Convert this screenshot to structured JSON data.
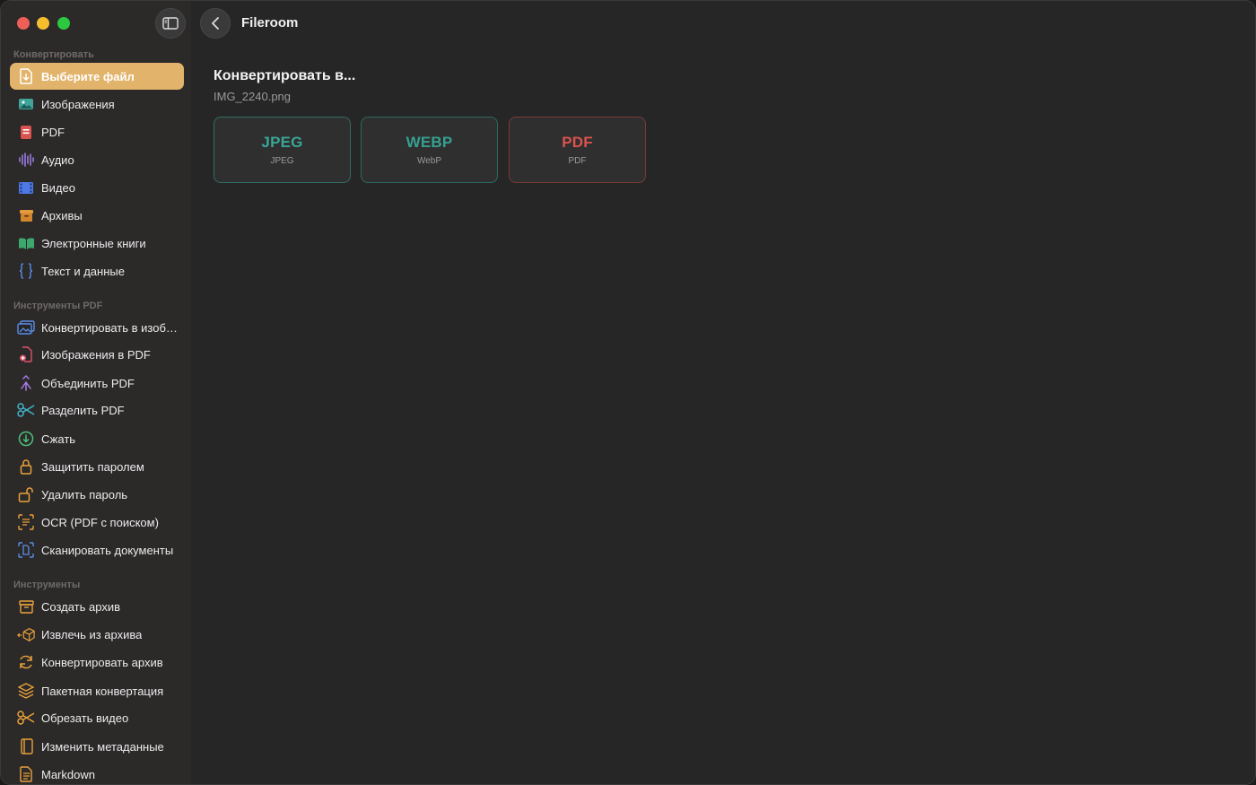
{
  "app": {
    "title": "Fileroom"
  },
  "sidebar": {
    "sections": [
      {
        "label": "Конвертировать"
      },
      {
        "label": "Инструменты PDF"
      },
      {
        "label": "Инструменты"
      }
    ],
    "convert_items": [
      {
        "label": "Выберите файл",
        "icon": "file-import-icon",
        "active": true
      },
      {
        "label": "Изображения",
        "icon": "image-icon"
      },
      {
        "label": "PDF",
        "icon": "pdf-icon"
      },
      {
        "label": "Аудио",
        "icon": "waveform-icon"
      },
      {
        "label": "Видео",
        "icon": "film-icon"
      },
      {
        "label": "Архивы",
        "icon": "archive-box-icon"
      },
      {
        "label": "Электронные книги",
        "icon": "book-icon"
      },
      {
        "label": "Текст и данные",
        "icon": "braces-icon"
      }
    ],
    "pdf_items": [
      {
        "label": "Конвертировать в изображения",
        "icon": "photos-icon"
      },
      {
        "label": "Изображения в PDF",
        "icon": "doc-plus-icon"
      },
      {
        "label": "Объединить PDF",
        "icon": "merge-icon"
      },
      {
        "label": "Разделить PDF",
        "icon": "scissors-icon"
      },
      {
        "label": "Сжать",
        "icon": "compress-icon"
      },
      {
        "label": "Защитить паролем",
        "icon": "lock-icon"
      },
      {
        "label": "Удалить пароль",
        "icon": "unlock-icon"
      },
      {
        "label": "OCR (PDF с поиском)",
        "icon": "text-scan-icon"
      },
      {
        "label": "Сканировать документы",
        "icon": "doc-scan-icon"
      }
    ],
    "tool_items": [
      {
        "label": "Создать архив",
        "icon": "archive-box-icon"
      },
      {
        "label": "Извлечь из архива",
        "icon": "extract-box-icon"
      },
      {
        "label": "Конвертировать архив",
        "icon": "refresh-icon"
      },
      {
        "label": "Пакетная конвертация",
        "icon": "stack-icon"
      },
      {
        "label": "Обрезать видео",
        "icon": "scissors-icon"
      },
      {
        "label": "Изменить метаданные",
        "icon": "book-closed-icon"
      },
      {
        "label": "Markdown",
        "icon": "document-icon"
      }
    ]
  },
  "main": {
    "heading": "Конвертировать в...",
    "filename": "IMG_2240.png",
    "formats": [
      {
        "label": "JPEG",
        "sub": "JPEG",
        "color": "#3aa597",
        "border": "#2f6e64"
      },
      {
        "label": "WEBP",
        "sub": "WebP",
        "color": "#35a091",
        "border": "#2d6a60"
      },
      {
        "label": "PDF",
        "sub": "PDF",
        "color": "#d9534f",
        "border": "#7a3a38"
      }
    ]
  },
  "colors": {
    "accent": "#e2b36a",
    "sidebar_bg": "#2c2929",
    "content_bg": "#262626"
  }
}
